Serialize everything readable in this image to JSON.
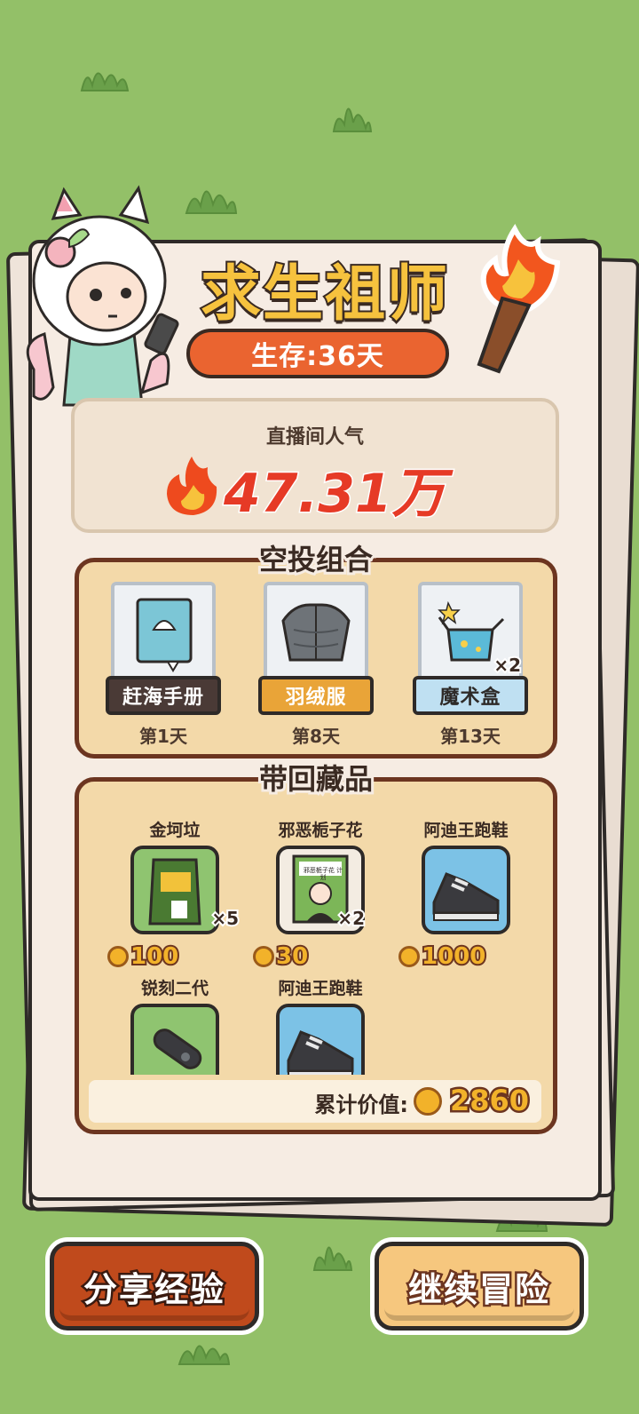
{
  "game": {
    "title": "求生祖师",
    "survival_label": "生存:36天"
  },
  "popularity": {
    "label": "直播间人气",
    "value": "47.31万"
  },
  "airdrop": {
    "title": "空投组合",
    "items": [
      {
        "name": "赶海手册",
        "day": "第1天",
        "count": "",
        "icon": "book-icon",
        "name_bg": "#4a3a36",
        "name_color": "#ffffff"
      },
      {
        "name": "羽绒服",
        "day": "第8天",
        "count": "",
        "icon": "jacket-icon",
        "name_bg": "#e9a438",
        "name_color": "#ffffff"
      },
      {
        "name": "魔术盒",
        "day": "第13天",
        "count": "×2",
        "icon": "magic-box-icon",
        "name_bg": "#bfe0f2",
        "name_color": "#2e2a28"
      }
    ]
  },
  "collection": {
    "title": "带回藏品",
    "items": [
      {
        "name": "金坷垃",
        "count": "×5",
        "price": "100",
        "icon": "fertilizer-bag-icon",
        "frame": "green"
      },
      {
        "name": "邪恶栀子花",
        "count": "×2",
        "price": "30",
        "icon": "book-cover-icon",
        "frame": "beige",
        "cover_text": "邪恶栀子花 计划"
      },
      {
        "name": "阿迪王跑鞋",
        "count": "",
        "price": "1000",
        "icon": "sneaker-icon",
        "frame": "blue"
      },
      {
        "name": "锐刻二代",
        "count": "",
        "price": "",
        "icon": "vape-icon",
        "frame": "green"
      },
      {
        "name": "阿迪王跑鞋",
        "count": "",
        "price": "",
        "icon": "sneaker-icon",
        "frame": "blue"
      }
    ],
    "total_label": "累计价值:",
    "total_value": "2860"
  },
  "buttons": {
    "share": "分享经验",
    "continue": "继续冒险"
  },
  "colors": {
    "background": "#93c068",
    "accent_orange": "#ea6430",
    "popularity_red": "#e63a26",
    "coin_gold": "#f2b22a",
    "section_border": "#6c3520"
  }
}
